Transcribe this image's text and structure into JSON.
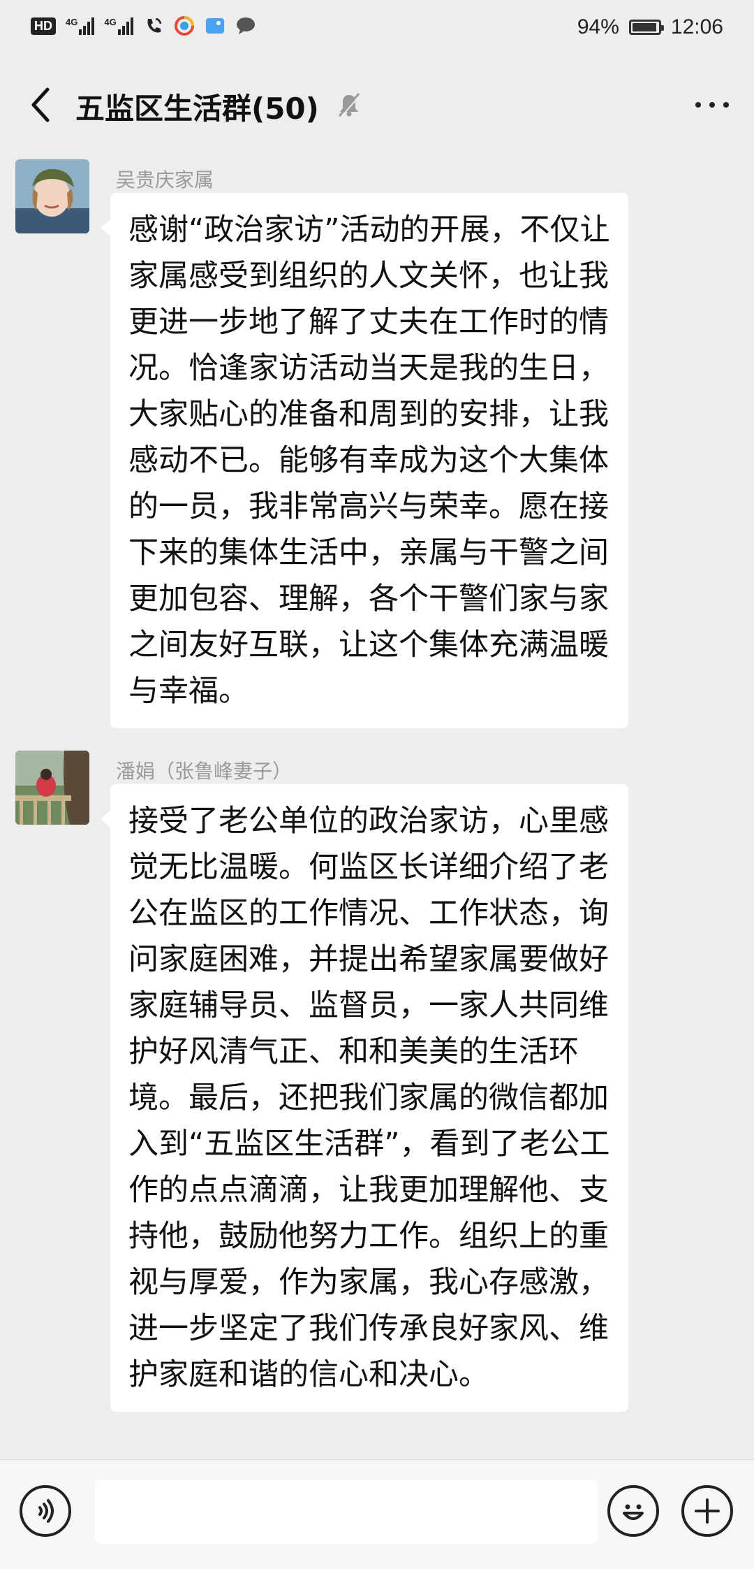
{
  "status_bar": {
    "hd_label": "HD",
    "sim1_label": "4G",
    "sim2_label": "4G",
    "battery_percent": 94,
    "battery_text": "94%",
    "time": "12:06"
  },
  "header": {
    "title": "五监区生活群(50)",
    "icons": [
      "back-arrow-icon",
      "mute-bell-icon",
      "more-icon"
    ]
  },
  "messages": [
    {
      "sender": "吴贵庆家属",
      "text": "感谢“政治家访”活动的开展，不仅让家属感受到组织的人文关怀，也让我更进一步地了解了丈夫在工作时的情况。恰逢家访活动当天是我的生日，大家贴心的准备和周到的安排，让我感动不已。能够有幸成为这个大集体的一员，我非常高兴与荣幸。愿在接下来的集体生活中，亲属与干警之间更加包容、理解，各个干警们家与家之间友好互联，让这个集体充满温暖与幸福。"
    },
    {
      "sender": "潘娟（张鲁峰妻子）",
      "text": "接受了老公单位的政治家访，心里感觉无比温暖。何监区长详细介绍了老公在监区的工作情况、工作状态，询问家庭困难，并提出希望家属要做好家庭辅导员、监督员，一家人共同维护好风清气正、和和美美的生活环境。最后，还把我们家属的微信都加入到“五监区生活群”，看到了老公工作的点点滴滴，让我更加理解他、支持他，鼓励他努力工作。组织上的重视与厚爱，作为家属，我心存感激，进一步坚定了我们传承良好家风、维护家庭和谐的信心和决心。"
    }
  ],
  "input_bar": {
    "value": "",
    "icons": [
      "voice-icon",
      "emoji-icon",
      "plus-icon"
    ]
  },
  "colors": {
    "background": "#ededed",
    "bubble": "#ffffff",
    "sender_name": "#9a9a9a"
  }
}
